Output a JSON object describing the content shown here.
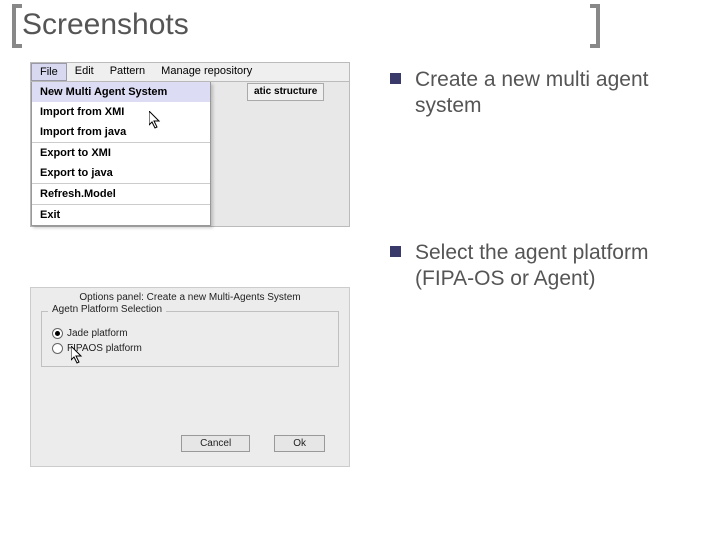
{
  "slide": {
    "title": "Screenshots"
  },
  "menubar": {
    "file": "File",
    "edit": "Edit",
    "pattern": "Pattern",
    "manage": "Manage repository"
  },
  "filemenu": {
    "new_mas": "New Multi Agent System",
    "import_xmi": "Import from XMI",
    "import_java": "Import from java",
    "export_xmi": "Export to XMI",
    "export_java": "Export to java",
    "refresh": "Refresh.Model",
    "exit": "Exit"
  },
  "tab": {
    "static_structure": "atic structure"
  },
  "options": {
    "title": "Options panel: Create a new Multi-Agents System",
    "group_label": "Agetn Platform Selection",
    "jade": "Jade platform",
    "fipaos": "FIPAOS platform",
    "cancel": "Cancel",
    "ok": "Ok"
  },
  "bullets": {
    "b1": "Create a new multi agent system",
    "b2": "Select the agent platform (FIPA-OS or Agent)"
  }
}
